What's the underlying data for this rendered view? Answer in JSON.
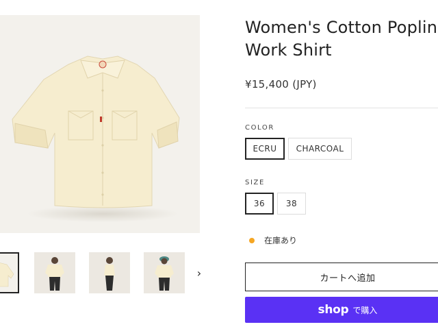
{
  "product": {
    "title": "Women's Cotton Poplin Work Shirt",
    "title_line1": "Women's Cotton Poplin",
    "title_line2": "Work Shirt",
    "price": "¥15,400 (JPY)"
  },
  "options": {
    "color": {
      "label": "COLOR",
      "values": [
        "ECRU",
        "CHARCOAL"
      ],
      "selected": "ECRU"
    },
    "size": {
      "label": "SIZE",
      "values": [
        "36",
        "38"
      ],
      "selected": "36"
    }
  },
  "stock": {
    "text": "在庫あり",
    "dot_color": "#f5a623"
  },
  "buttons": {
    "add_to_cart": "カートへ追加",
    "shop_pay_logo": "shop",
    "shop_pay_text": "で購入"
  },
  "gallery": {
    "thumbnails": [
      "shirt-flat",
      "model-front",
      "model-side",
      "model-back"
    ],
    "active_thumbnail": 0,
    "next_icon": "›"
  },
  "colors": {
    "accent_shop": "#5a31f4",
    "shirt": "#f6edcf"
  }
}
